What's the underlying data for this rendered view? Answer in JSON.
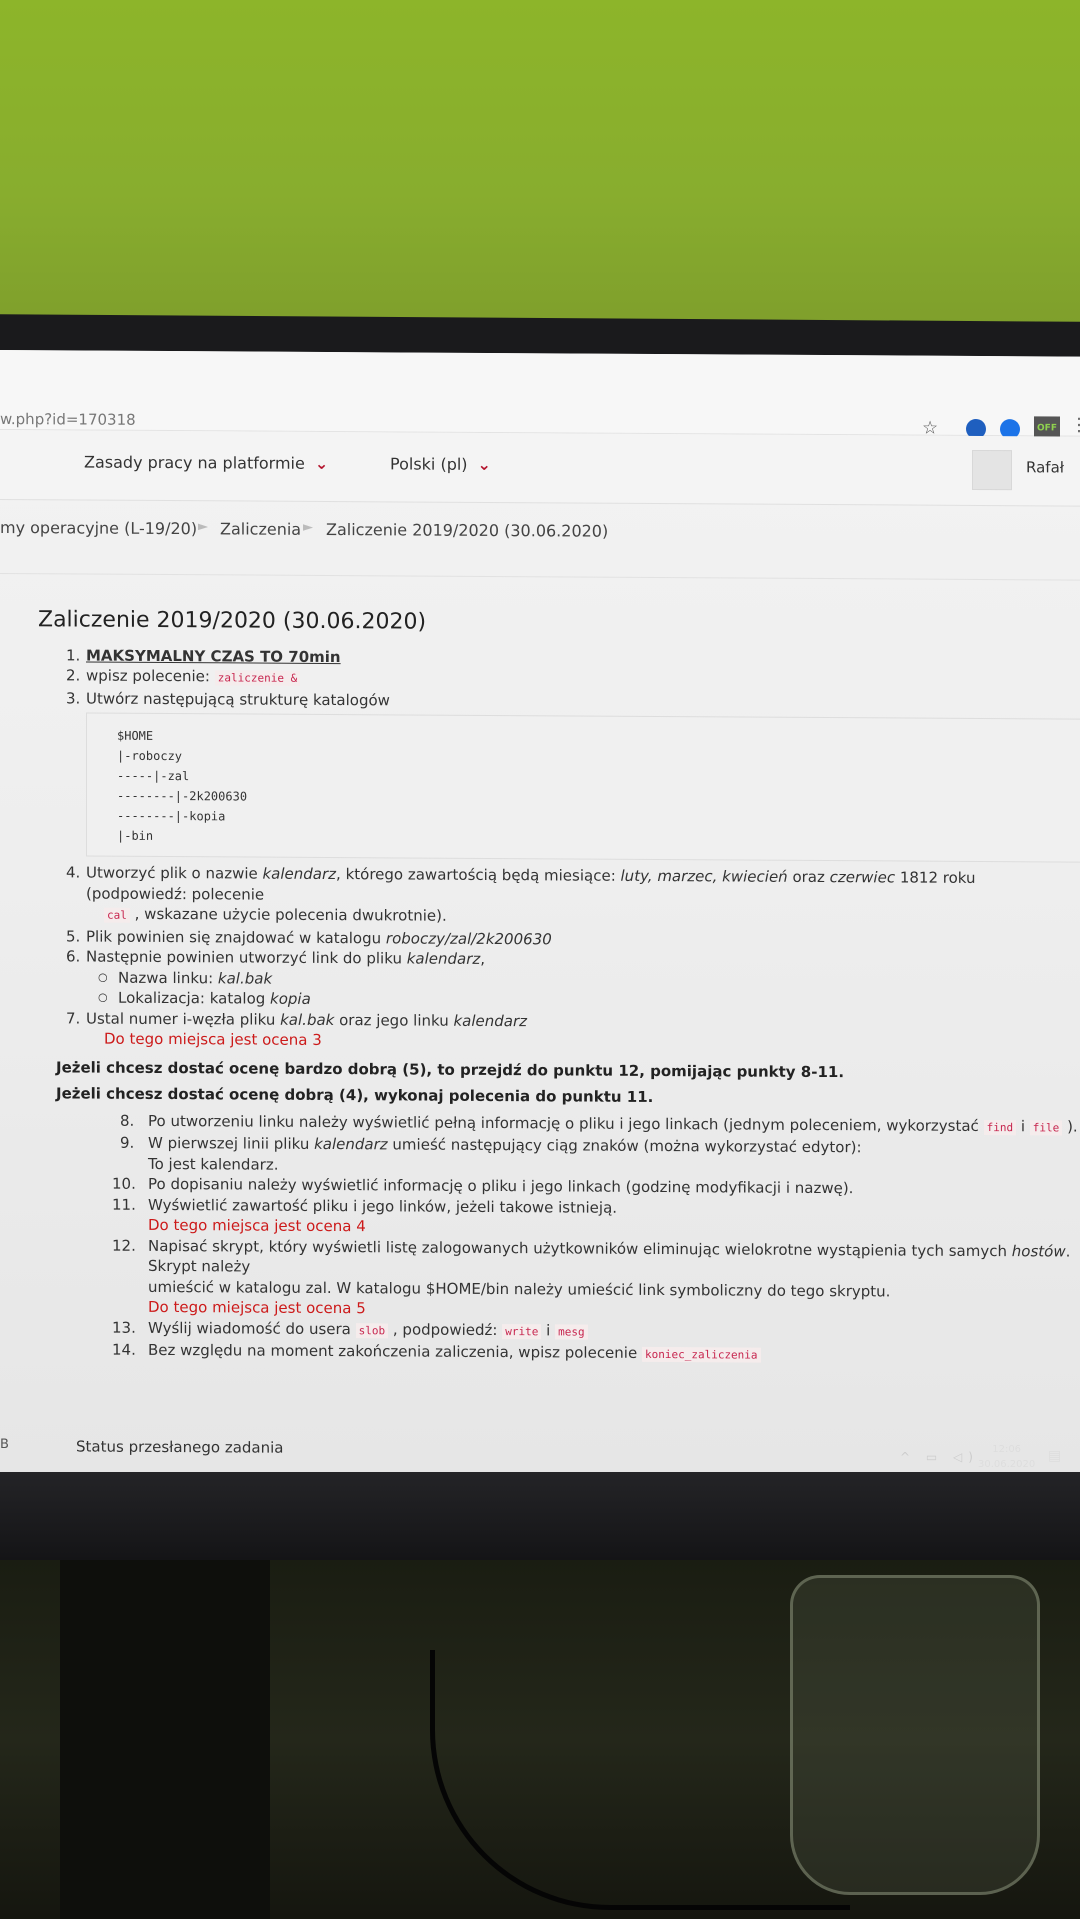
{
  "browser": {
    "url": "w.php?id=170318",
    "ext_badge": "OFF",
    "star_icon": "star-icon"
  },
  "navbar": {
    "rules_label": "Zasady pracy na platformie",
    "language_label": "Polski (pl)",
    "user_name": "Rafał"
  },
  "breadcrumb": {
    "course": "my operacyjne (L-19/20)",
    "section": "Zaliczenia",
    "current": "Zaliczenie 2019/2020 (30.06.2020)"
  },
  "content": {
    "title": "Zaliczenie 2019/2020 (30.06.2020)",
    "item1": {
      "num": "1.",
      "text": "MAKSYMALNY CZAS TO 70min"
    },
    "item2": {
      "num": "2.",
      "text": "wpisz polecenie:",
      "code": "zaliczenie &"
    },
    "item3": {
      "num": "3.",
      "text": "Utwórz następującą strukturę katalogów"
    },
    "tree": [
      "$HOME",
      "|-roboczy",
      "-----|-zal",
      "--------|-2k200630",
      "--------|-kopia",
      "|-bin"
    ],
    "item4": {
      "num": "4.",
      "a": "Utworzyć plik o nazwie ",
      "file": "kalendarz",
      "b": ", którego zawartością będą miesiące: ",
      "months": "luty, marzec, kwiecień",
      "c": " oraz ",
      "june": "czerwiec",
      "d": " 1812 roku (podpowiedź: polecenie",
      "code": "cal",
      "e": " , wskazane użycie polecenia dwukrotnie)."
    },
    "item5": {
      "num": "5.",
      "a": "Plik powinien się znajdować w katalogu ",
      "path": "roboczy/zal/2k200630"
    },
    "item6": {
      "num": "6.",
      "a": "Następnie powinien utworzyć link do pliku ",
      "file": "kalendarz",
      "b": ","
    },
    "item6_sub1": {
      "label": "Nazwa linku: ",
      "value": "kal.bak"
    },
    "item6_sub2": {
      "label": "Lokalizacja: katalog ",
      "value": "kopia"
    },
    "item7": {
      "num": "7.",
      "a": "Ustal numer i-węzła pliku ",
      "file": "kal.bak",
      "b": " oraz jego linku ",
      "link": "kalendarz"
    },
    "grade3": "Do tego miejsca jest ocena 3",
    "grade5_line": "Jeżeli chcesz dostać ocenę bardzo dobrą (5), to przejdź do punktu 12, pomijając punkty 8-11.",
    "grade4_line": "Jeżeli chcesz dostać ocenę dobrą (4), wykonaj polecenia do punktu 11.",
    "item8": {
      "num": "8.",
      "a": "Po utworzeniu linku należy wyświetlić pełną informację o pliku i jego linkach (jednym poleceniem, wykorzystać ",
      "code1": "find",
      "b": " i ",
      "code2": "file",
      "c": " )."
    },
    "item9": {
      "num": "9.",
      "a": "W pierwszej linii pliku ",
      "file": "kalendarz",
      "b": " umieść następujący ciąg znaków (można wykorzystać edytor):",
      "line2": "To jest kalendarz."
    },
    "item10": {
      "num": "10.",
      "text": "Po dopisaniu należy wyświetlić informację o pliku i jego linkach (godzinę modyfikacji i nazwę)."
    },
    "item11": {
      "num": "11.",
      "text": "Wyświetlić zawartość pliku i jego linków, jeżeli takowe istnieją."
    },
    "grade4": "Do tego miejsca jest ocena 4",
    "item12": {
      "num": "12.",
      "a": "Napisać skrypt, który wyświetli listę zalogowanych użytkowników eliminując wielokrotne wystąpienia tych samych ",
      "hosts": "hostów",
      "b": ". Skrypt należy",
      "line2": "umieścić w katalogu zal. W katalogu $HOME/bin należy umieścić link symboliczny do tego skryptu."
    },
    "grade5": "Do tego miejsca jest ocena 5",
    "item13": {
      "num": "13.",
      "a": "Wyślij wiadomość do usera ",
      "code1": "slob",
      "b": " , podpowiedź: ",
      "code2": "write",
      "c": " i ",
      "code3": "mesg"
    },
    "item14": {
      "num": "14.",
      "a": "Bez względu na moment zakończenia zaliczenia, wpisz polecenie ",
      "code": "koniec_zaliczenia"
    }
  },
  "footer": {
    "status": "Status przesłanego zadania",
    "edge_letter": "B"
  },
  "taskbar": {
    "time": "12:06",
    "date": "30.06.2020"
  }
}
